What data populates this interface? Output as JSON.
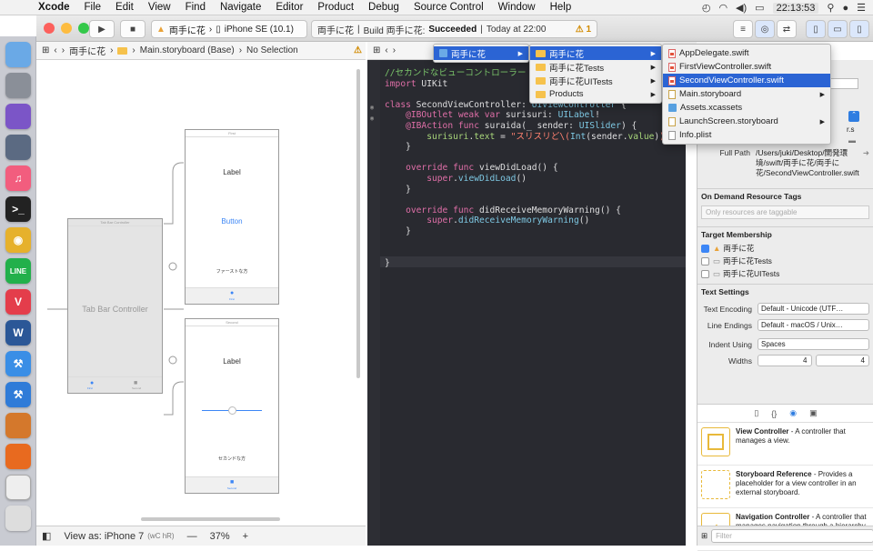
{
  "menubar": {
    "app": "Xcode",
    "items": [
      "File",
      "Edit",
      "View",
      "Find",
      "Navigate",
      "Editor",
      "Product",
      "Debug",
      "Source Control",
      "Window",
      "Help"
    ],
    "clock": "22:13:53"
  },
  "toolbar": {
    "scheme": "両手に花",
    "device": "iPhone SE (10.1)",
    "status_project": "両手に花",
    "status_build": "Build 両手に花:",
    "status_result": "Succeeded",
    "status_time": "Today at 22:00",
    "warning_count": "1"
  },
  "ib_path": {
    "crumbs": [
      "両手に花",
      "Main.storyboard (Base)",
      "No Selection"
    ]
  },
  "storyboard": {
    "tab_bar_title": "Tab Bar Controller",
    "tab_bar_label": "Tab Bar Controller",
    "first_title": "First",
    "first_label": "Label",
    "first_button": "Button",
    "first_text": "ファーストな方",
    "first_tab": "First",
    "second_title": "Second",
    "second_label": "Label",
    "second_text": "セカンドな方",
    "second_tab": "Second",
    "tab_first_mini": "First",
    "tab_second_mini": "Second"
  },
  "bottom_bar": {
    "view_as": "View as: iPhone 7",
    "traits": "(wC hR)",
    "zoom": "37%"
  },
  "code_lines": [
    "//セカンドなビューコントローラー",
    "import UIKit",
    "",
    "class SecondViewController: UIViewController {",
    "    @IBOutlet weak var surisuri: UILabel!",
    "    @IBAction func suraida(_ sender: UISlider) {",
    "        surisuri.text = \"スリスリど\\(Int(sender.value))%\"",
    "    }",
    "",
    "    override func viewDidLoad() {",
    "        super.viewDidLoad()",
    "    }",
    "",
    "    override func didReceiveMemoryWarning() {",
    "        super.didReceiveMemoryWarning()",
    "    }",
    "",
    "",
    "}"
  ],
  "jump_menu": {
    "level1": [
      "両手に花"
    ],
    "level2": [
      "両手に花",
      "両手に花Tests",
      "両手に花UITests",
      "Products"
    ],
    "level3": [
      "AppDelegate.swift",
      "FirstViewController.swift",
      "SecondViewController.swift",
      "Main.storyboard",
      "Assets.xcassets",
      "LaunchScreen.storyboard",
      "Info.plist"
    ],
    "selected": "SecondViewController.swift"
  },
  "inspector": {
    "name_field": "r.swift",
    "location_tail": "r.s",
    "full_path_label": "Full Path",
    "full_path": "/Users/juki/Desktop/開発環境/swift/両手に花/両手に花/SecondViewController.swift",
    "odr_header": "On Demand Resource Tags",
    "odr_placeholder": "Only resources are taggable",
    "target_header": "Target Membership",
    "targets": [
      "両手に花",
      "両手に花Tests",
      "両手に花UITests"
    ],
    "text_header": "Text Settings",
    "text_encoding_label": "Text Encoding",
    "text_encoding": "Default - Unicode (UTF…",
    "line_endings_label": "Line Endings",
    "line_endings": "Default - macOS / Unix…",
    "indent_label": "Indent Using",
    "indent": "Spaces",
    "widths_label": "Widths",
    "width_a": "4",
    "width_b": "4",
    "library": [
      {
        "title": "View Controller",
        "desc": " - A controller that manages a view."
      },
      {
        "title": "Storyboard Reference",
        "desc": " - Provides a placeholder for a view controller in an external storyboard."
      },
      {
        "title": "Navigation Controller",
        "desc": " - A controller that manages navigation through a hierarchy of views."
      }
    ],
    "filter_placeholder": "Filter"
  }
}
